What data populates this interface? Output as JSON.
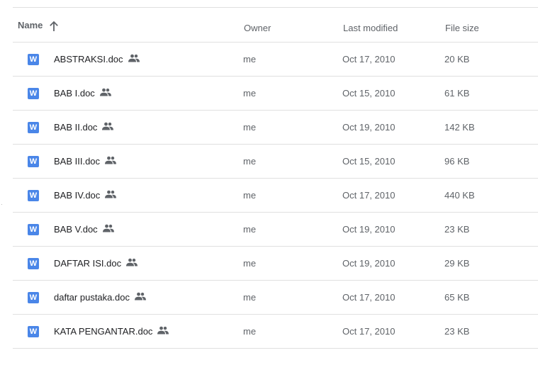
{
  "header": {
    "name_label": "Name",
    "owner_label": "Owner",
    "modified_label": "Last modified",
    "size_label": "File size",
    "sort_icon": "arrow-up-icon"
  },
  "files": [
    {
      "name": "ABSTRAKSI.doc",
      "owner": "me",
      "modified": "Oct 17, 2010",
      "size": "20 KB"
    },
    {
      "name": "BAB I.doc",
      "owner": "me",
      "modified": "Oct 15, 2010",
      "size": "61 KB"
    },
    {
      "name": "BAB II.doc",
      "owner": "me",
      "modified": "Oct 19, 2010",
      "size": "142 KB"
    },
    {
      "name": "BAB III.doc",
      "owner": "me",
      "modified": "Oct 15, 2010",
      "size": "96 KB"
    },
    {
      "name": "BAB IV.doc",
      "owner": "me",
      "modified": "Oct 17, 2010",
      "size": "440 KB"
    },
    {
      "name": "BAB V.doc",
      "owner": "me",
      "modified": "Oct 19, 2010",
      "size": "23 KB"
    },
    {
      "name": "DAFTAR ISI.doc",
      "owner": "me",
      "modified": "Oct 19, 2010",
      "size": "29 KB"
    },
    {
      "name": "daftar pustaka.doc",
      "owner": "me",
      "modified": "Oct 17, 2010",
      "size": "65 KB"
    },
    {
      "name": "KATA PENGANTAR.doc",
      "owner": "me",
      "modified": "Oct 17, 2010",
      "size": "23 KB"
    }
  ],
  "icons": {
    "file_type": "word-doc-icon",
    "file_type_letter": "W",
    "shared": "shared-people-icon"
  },
  "colors": {
    "word_blue": "#4a86e8",
    "divider": "#e0e0e0",
    "text_primary": "#202124",
    "text_secondary": "#5f6368"
  }
}
